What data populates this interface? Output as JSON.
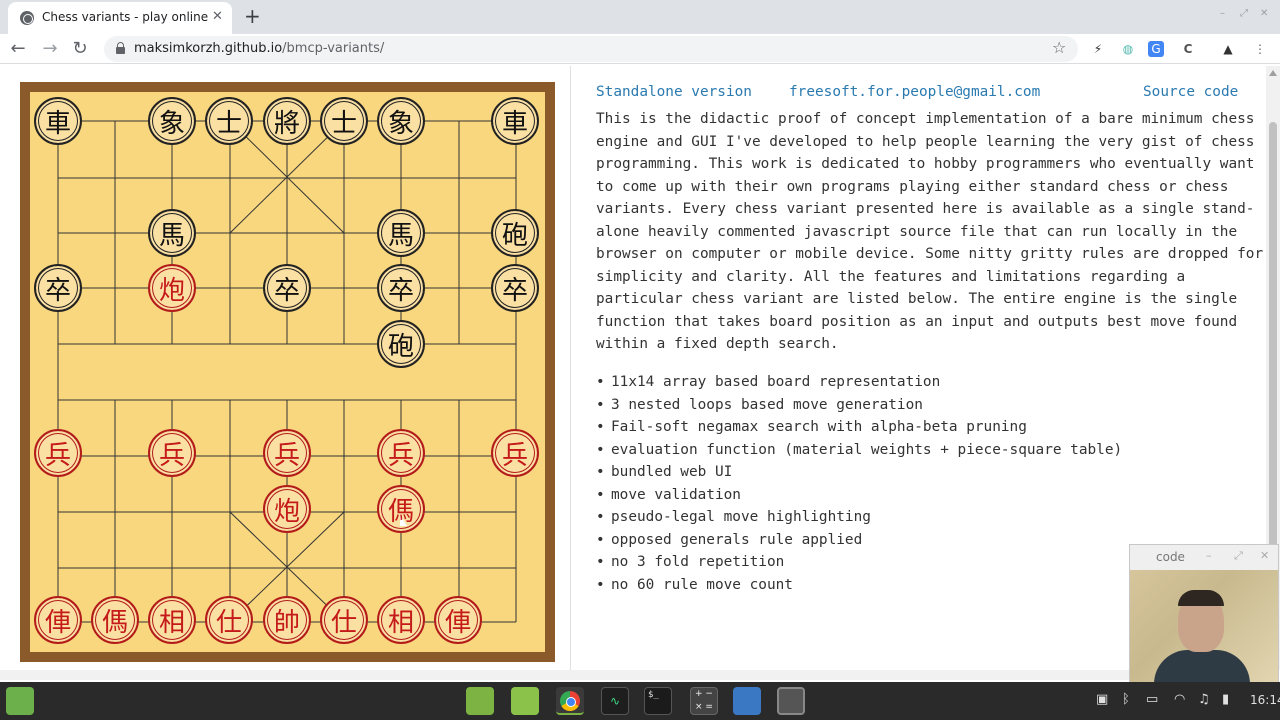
{
  "browser": {
    "tab_title": "Chess variants - play online",
    "url_host": "maksimkorzh.github.io",
    "url_path": "/bmcp-variants/"
  },
  "links": {
    "standalone": "Standalone version",
    "email": "freesoft.for.people@gmail.com",
    "source": "Source code"
  },
  "description": "This is the didactic proof of concept implementation of a bare minimum chess engine and GUI I've developed to help people learning the very gist of chess programming. This work is dedicated to hobby programmers who eventually want to come up with their own programs playing either standard chess or chess variants. Every chess variant presented here is available as a single stand-alone heavily commented javascript source file that can run locally in the browser on computer or mobile device. Some nitty gritty rules are dropped for simplicity and clarity. All the features and limitations regarding a particular chess variant are listed below. The entire engine is the single function that takes board position as an input and outputs best move found within a fixed depth search.",
  "features": [
    "11x14 array based board representation",
    "3 nested loops based move generation",
    "Fail-soft negamax search with alpha-beta pruning",
    "evaluation function (material weights + piece-square table)",
    "bundled web UI",
    "move validation",
    "pseudo-legal move highlighting",
    "opposed generals rule applied",
    "no 3 fold repetition",
    "no 60 rule move count"
  ],
  "pieces": {
    "b_chariot_l": "車",
    "b_elephant_l": "象",
    "b_advisor_l": "士",
    "b_general": "將",
    "b_advisor_r": "士",
    "b_elephant_r": "象",
    "b_chariot_r": "車",
    "b_horse_l": "馬",
    "b_horse_r": "馬",
    "b_cannon_r": "砲",
    "b_cannon_sel": "砲",
    "b_soldier_1": "卒",
    "b_soldier_3": "卒",
    "b_soldier_4": "卒",
    "b_soldier_5": "卒",
    "r_cannon_top": "炮",
    "r_soldier_1": "兵",
    "r_soldier_2": "兵",
    "r_soldier_3": "兵",
    "r_soldier_4": "兵",
    "r_soldier_5": "兵",
    "r_cannon": "炮",
    "r_horse_mid": "傌",
    "r_chariot_l": "俥",
    "r_horse_l": "傌",
    "r_elephant_l": "相",
    "r_advisor_l": "仕",
    "r_general": "帥",
    "r_advisor_r": "仕",
    "r_elephant_r": "相",
    "r_chariot_r": "俥"
  },
  "webcam": {
    "title": "code"
  },
  "taskbar": {
    "clock": "16:14"
  }
}
